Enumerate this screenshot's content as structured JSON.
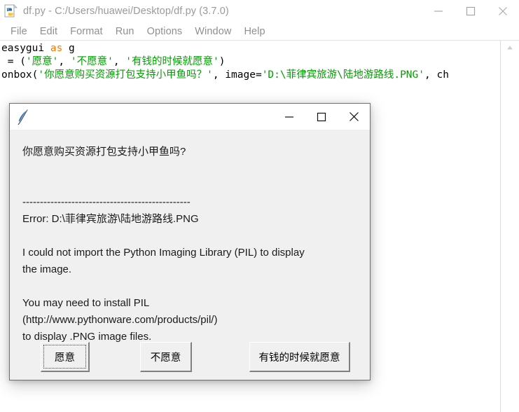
{
  "idle": {
    "app_icon": "python-idle-icon",
    "title": "df.py - C:/Users/huawei/Desktop/df.py (3.7.0)",
    "window_controls": [
      {
        "name": "minimize-button",
        "glyph": "minimize-icon"
      },
      {
        "name": "maximize-button",
        "glyph": "maximize-icon"
      },
      {
        "name": "close-button",
        "glyph": "close-icon"
      }
    ],
    "menu": [
      "File",
      "Edit",
      "Format",
      "Run",
      "Options",
      "Window",
      "Help"
    ],
    "code_lines": [
      [
        {
          "text": "easygui ",
          "type": "plain"
        },
        {
          "text": "as",
          "type": "keyword"
        },
        {
          "text": " g",
          "type": "plain"
        }
      ],
      [
        {
          "text": " = (",
          "type": "plain"
        },
        {
          "text": "'愿意'",
          "type": "string"
        },
        {
          "text": ", ",
          "type": "plain"
        },
        {
          "text": "'不愿意'",
          "type": "string"
        },
        {
          "text": ", ",
          "type": "plain"
        },
        {
          "text": "'有钱的时候就愿意'",
          "type": "string"
        },
        {
          "text": ")",
          "type": "plain"
        }
      ],
      [
        {
          "text": "onbox(",
          "type": "plain"
        },
        {
          "text": "'你愿意购买资源打包支持小甲鱼吗？'",
          "type": "string"
        },
        {
          "text": ", image=",
          "type": "plain"
        },
        {
          "text": "'D:\\菲律宾旅游\\陆地游路线.PNG'",
          "type": "string"
        },
        {
          "text": ", ch",
          "type": "plain"
        }
      ]
    ],
    "scrollbar": {
      "up_arrow": "scroll-up-arrow-icon"
    }
  },
  "dialog": {
    "app_icon": "tkinter-feather-icon",
    "title": "",
    "window_controls": [
      {
        "name": "minimize-button",
        "glyph": "minimize-icon"
      },
      {
        "name": "maximize-button",
        "glyph": "maximize-icon"
      },
      {
        "name": "close-button",
        "glyph": "close-icon"
      }
    ],
    "message": "你愿意购买资源打包支持小甲鱼吗?\n\n\n------------------------------------------------\nError: D:\\菲律宾旅游\\陆地游路线.PNG\n\nI could not import the Python Imaging Library (PIL) to display\nthe image.\n\nYou may need to install PIL\n(http://www.pythonware.com/products/pil/)\nto display .PNG image files.",
    "buttons": {
      "yes": "愿意",
      "no": "不愿意",
      "rich": "有钱的时候就愿意"
    }
  },
  "colors": {
    "dialog_bg": "#f0f0f0",
    "titlebar_bg": "#ffffff",
    "code_string": "#00a000",
    "code_keyword": "#ff7700",
    "idle_text": "#9a9a9a"
  }
}
